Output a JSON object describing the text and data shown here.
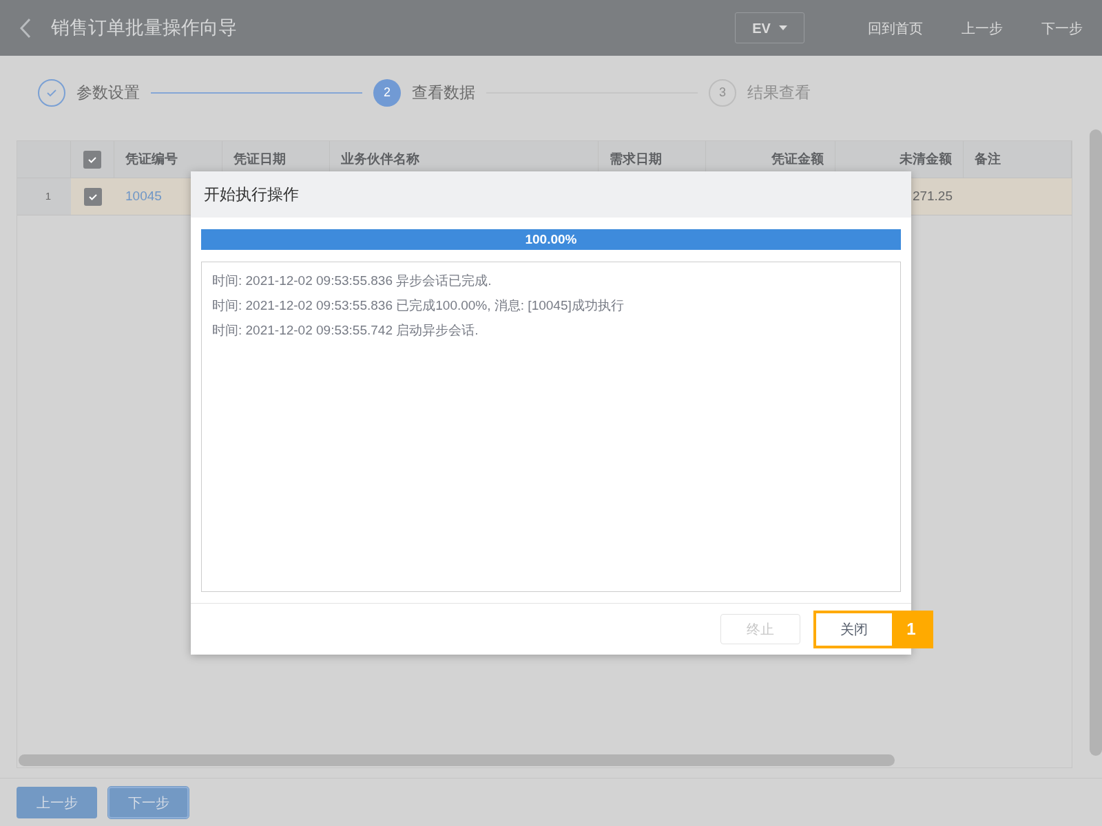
{
  "header": {
    "title": "销售订单批量操作向导",
    "dropdown": "EV",
    "actions": [
      "回到首页",
      "上一步",
      "下一步"
    ]
  },
  "steps": [
    {
      "label": "参数设置",
      "completed": true,
      "selected": false
    },
    {
      "number": "2",
      "label": "查看数据",
      "completed": false,
      "selected": true
    },
    {
      "number": "3",
      "label": "结果查看",
      "completed": false,
      "selected": false
    }
  ],
  "table": {
    "header_checked": true,
    "columns": [
      "凭证编号",
      "凭证日期",
      "业务伙伴名称",
      "需求日期",
      "凭证金额",
      "未清金额",
      "备注"
    ],
    "rows": [
      {
        "index": "1",
        "checked": true,
        "cells": [
          "10045",
          "",
          "",
          "",
          "",
          "271.25",
          ""
        ]
      }
    ]
  },
  "dialog": {
    "title": "开始执行操作",
    "progress": {
      "level": 1,
      "reading": "100.00%"
    },
    "log": [
      "时间: 2021-12-02 09:53:55.836 异步会话已完成.",
      "时间: 2021-12-02 09:53:55.836 已完成100.00%, 消息: [10045]成功执行",
      "时间: 2021-12-02 09:53:55.742 启动异步会话."
    ],
    "buttons": [
      {
        "label": "终止",
        "disabled": true
      },
      {
        "label": "关闭",
        "disabled": false,
        "marker": "1"
      }
    ]
  },
  "footer_buttons": [
    {
      "label": "上一步",
      "focused": false
    },
    {
      "label": "下一步",
      "focused": true
    }
  ]
}
